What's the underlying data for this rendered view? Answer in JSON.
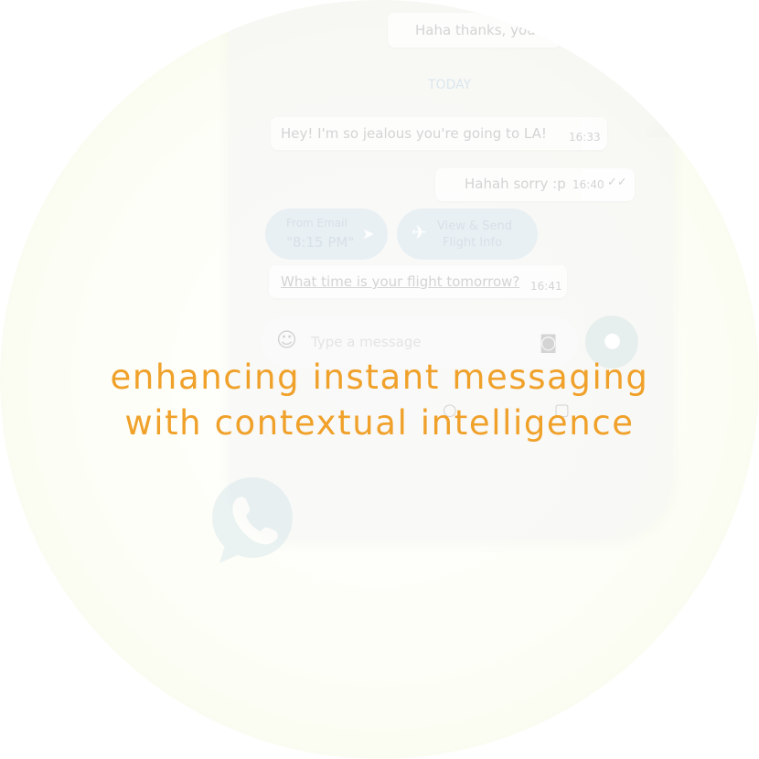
{
  "tagline": {
    "line1": "enhancing instant messaging",
    "line2": "with contextual intelligence"
  },
  "chat": {
    "top_bubble": "Haha thanks, you",
    "date_divider": "TODAY",
    "messages": [
      {
        "text": "Hey! I'm so jealous you're going to LA!",
        "time": "16:33"
      },
      {
        "text": "Hahah sorry :p",
        "time": "16:40"
      },
      {
        "text": "What time is your flight tomorrow?",
        "time": "16:41"
      }
    ],
    "chips": [
      {
        "line1": "From Email",
        "line2": "\"8:15 PM\""
      },
      {
        "line1": "View & Send",
        "line2": "Flight Info"
      }
    ],
    "input_placeholder": "Type a message"
  },
  "colors": {
    "accent": "#f0a12a",
    "whatsapp": "#25d366"
  },
  "icons": [
    "emoji-icon",
    "camera-icon",
    "microphone-icon",
    "send-icon",
    "airplane-icon",
    "whatsapp-icon"
  ]
}
